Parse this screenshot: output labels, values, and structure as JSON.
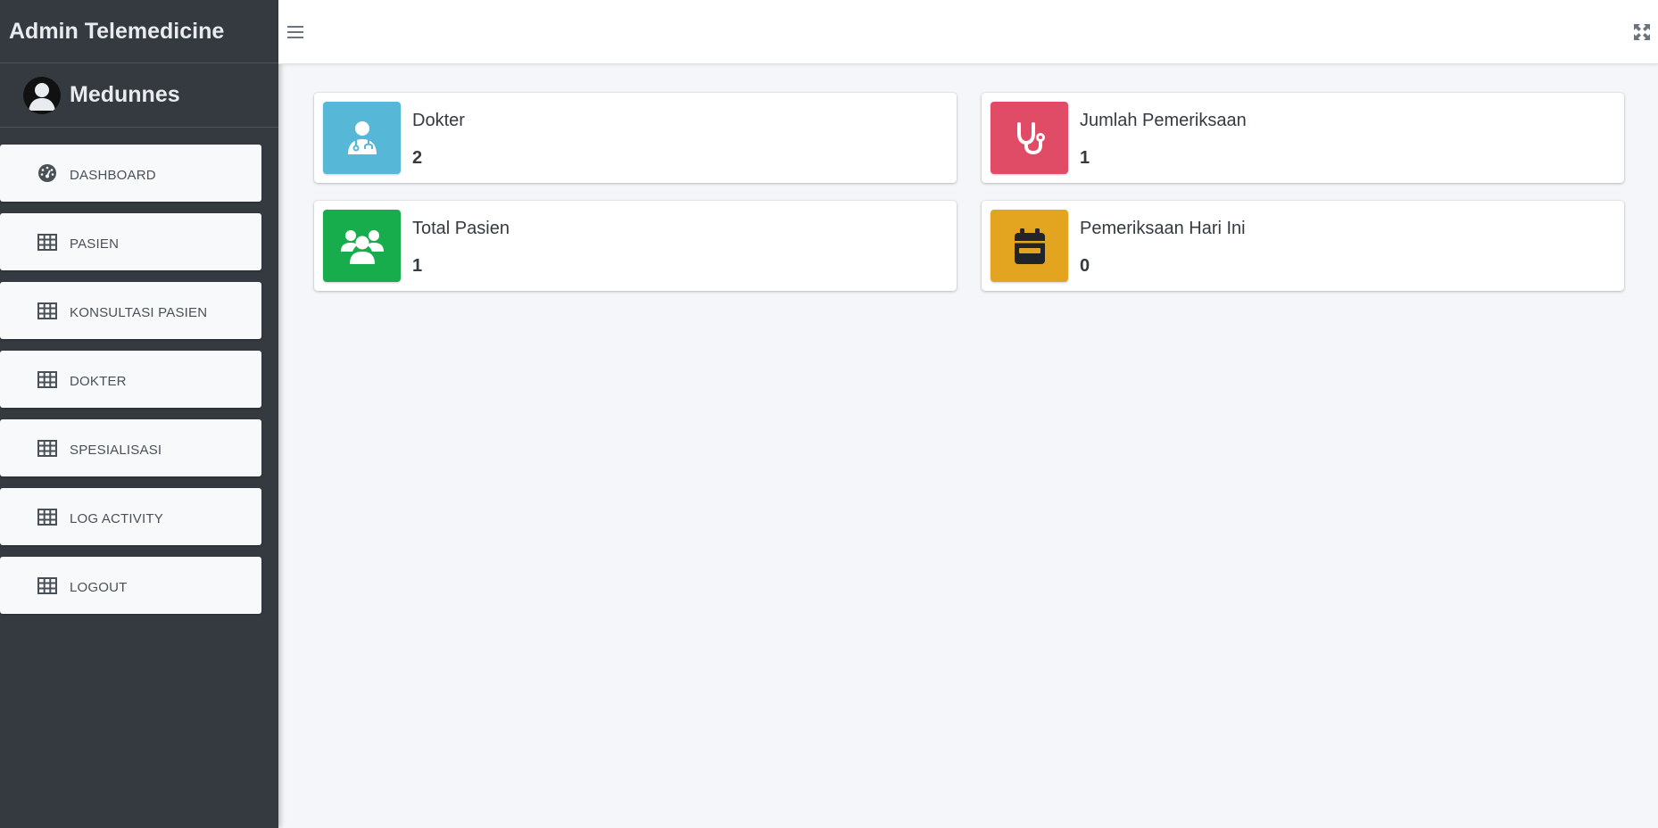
{
  "brand": {
    "title": "Admin Telemedicine"
  },
  "user": {
    "name": "Medunnes"
  },
  "sidebar": {
    "items": [
      {
        "label": "DASHBOARD",
        "icon": "tachometer-icon"
      },
      {
        "label": "PASIEN",
        "icon": "table-icon"
      },
      {
        "label": "KONSULTASI PASIEN",
        "icon": "table-icon"
      },
      {
        "label": "DOKTER",
        "icon": "table-icon"
      },
      {
        "label": "SPESIALISASI",
        "icon": "table-icon"
      },
      {
        "label": "LOG ACTIVITY",
        "icon": "table-icon"
      },
      {
        "label": "LOGOUT",
        "icon": "table-icon"
      }
    ]
  },
  "topbar": {
    "menu_icon": "bars-icon",
    "fullscreen_icon": "expand-icon"
  },
  "stats": [
    {
      "label": "Dokter",
      "value": "2",
      "icon": "user-doctor-icon",
      "color": "#56b7d6"
    },
    {
      "label": "Jumlah Pemeriksaan",
      "value": "1",
      "icon": "stethoscope-icon",
      "color": "#e04b66"
    },
    {
      "label": "Total Pasien",
      "value": "1",
      "icon": "users-icon",
      "color": "#17ad4d"
    },
    {
      "label": "Pemeriksaan Hari Ini",
      "value": "0",
      "icon": "calendar-icon",
      "color": "#e3a51f"
    }
  ]
}
